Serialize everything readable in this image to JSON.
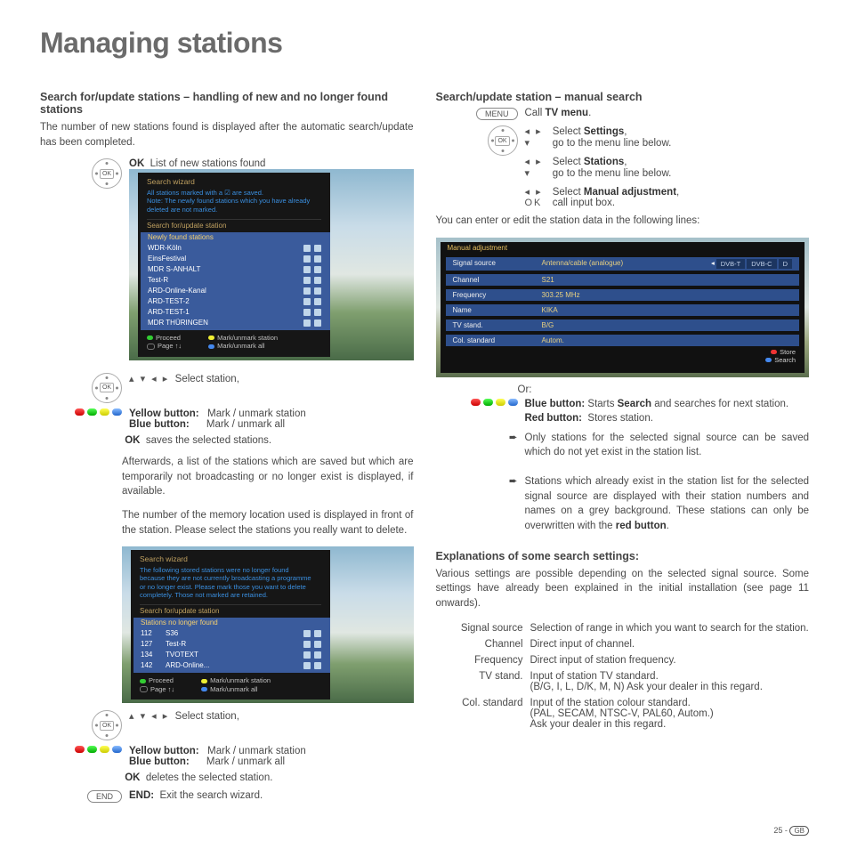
{
  "page_title": "Managing stations",
  "footer": {
    "page_num": "25 -",
    "region": "GB"
  },
  "left": {
    "h1": "Search for/update stations – handling of new and no longer found stations",
    "p1": "The number of new stations found is displayed after the automatic search/update has been completed.",
    "ok_line": {
      "prefix": "OK",
      "text": "List of new stations found"
    },
    "wizard1": {
      "header": "Search wizard",
      "note1": "All stations marked with a ☑ are saved.",
      "note2": "Note: The newly found stations which you have already deleted are not marked.",
      "tab1": "Search for/update station",
      "tab2": "Newly found stations",
      "rows": [
        "WDR-Köln",
        "EinsFestival",
        "MDR S-ANHALT",
        "Test-R",
        "ARD-Online-Kanal",
        "ARD-TEST-2",
        "ARD-TEST-1",
        "MDR THÜRINGEN"
      ],
      "legend": {
        "proceed": "Proceed",
        "page": "Page ↑↓",
        "mark": "Mark/unmark station",
        "markall": "Mark/unmark all"
      }
    },
    "select_station": "Select station,",
    "yellow_label": "Yellow button:",
    "yellow_text": "Mark / unmark station",
    "blue_label": "Blue button:",
    "blue_text": "Mark / unmark all",
    "ok_saves": {
      "prefix": "OK",
      "text": "saves the selected stations."
    },
    "p2": "Afterwards, a list of the stations which are saved but which are temporarily not broadcasting or no longer exist is displayed, if available.",
    "p3": "The number of the memory location used is displayed in front of the station. Please select the stations you really want to delete.",
    "wizard2": {
      "header": "Search wizard",
      "note": "The following stored stations were no longer found because they are not currently broadcasting a programme or no longer exist. Please mark those you want to delete completely. Those not marked are retained.",
      "tab1": "Search for/update station",
      "tab2": "Stations no longer found",
      "rows": [
        {
          "num": "112",
          "name": "S36"
        },
        {
          "num": "127",
          "name": "Test-R"
        },
        {
          "num": "134",
          "name": "TVOTEXT"
        },
        {
          "num": "142",
          "name": "ARD-Online..."
        }
      ],
      "legend": {
        "proceed": "Proceed",
        "page": "Page ↑↓",
        "mark": "Mark/unmark station",
        "markall": "Mark/unmark all"
      }
    },
    "ok_deletes": {
      "prefix": "OK",
      "text": "deletes the selected station."
    },
    "end": {
      "label": "END",
      "prefix": "END:",
      "text": "Exit the search wizard."
    }
  },
  "right": {
    "h1": "Search/update station – manual search",
    "menu_pill": "MENU",
    "call_tv": {
      "plain": "Call ",
      "bold": "TV menu",
      "tail": "."
    },
    "steps": [
      {
        "arrows": "◂ ▸",
        "plain": "Select ",
        "bold": "Settings",
        "tail": ","
      },
      {
        "arrows": "▾",
        "plain": "go to the menu line below."
      },
      {
        "arrows": "◂ ▸",
        "plain": "Select ",
        "bold": "Stations",
        "tail": ","
      },
      {
        "arrows": "▾",
        "plain": "go to the menu line below."
      },
      {
        "arrows": "◂ ▸",
        "plain": "Select ",
        "bold": "Manual adjustment",
        "tail": ","
      },
      {
        "arrows": "OK",
        "plain": "call input box."
      }
    ],
    "p_intro": "You can enter or edit the station data in the following lines:",
    "manual_panel": {
      "title": "Manual adjustment",
      "rows": [
        {
          "l": "Signal source",
          "r": "Antenna/cable (analogue)"
        },
        {
          "l": "Channel",
          "r": "S21"
        },
        {
          "l": "Frequency",
          "r": "303.25 MHz"
        },
        {
          "l": "Name",
          "r": "KIKA"
        },
        {
          "l": "TV stand.",
          "r": "B/G"
        },
        {
          "l": "Col. standard",
          "r": "Autom."
        }
      ],
      "tabs": [
        "DVB-T",
        "DVB-C",
        "D"
      ],
      "legend": {
        "store": "Store",
        "search": "Search"
      }
    },
    "or": "Or:",
    "blue": {
      "label": "Blue button:",
      "text_plain": "Starts ",
      "text_bold": "Search",
      "text_tail": " and searches for next station."
    },
    "red": {
      "label": "Red button:",
      "text": "Stores station."
    },
    "bullet1": "Only stations for the selected signal source can be saved which do not yet exist in the station list.",
    "bullet2_a": "Stations which already exist in the station list for the selected signal source are displayed with their station numbers and names on a grey background. These stations can only be overwritten with the ",
    "bullet2_b": "red button",
    "bullet2_c": ".",
    "h2": "Explanations of some search settings:",
    "p_expl": "Various settings are possible depending on the selected signal source. Some settings have already been explained in the initial installation (see page 11 onwards).",
    "settings": [
      {
        "k": "Signal source",
        "v": "Selection of range in which you want to search for the station."
      },
      {
        "k": "Channel",
        "v": "Direct input of channel."
      },
      {
        "k": "Frequency",
        "v": "Direct input of station frequency."
      },
      {
        "k": "TV stand.",
        "v": "Input of station TV standard.\n(B/G, I, L, D/K, M, N) Ask your dealer in this regard."
      },
      {
        "k": "Col. standard",
        "v": "Input of the station colour standard.\n(PAL, SECAM, NTSC-V, PAL60, Autom.)\nAsk your dealer in this regard."
      }
    ]
  }
}
